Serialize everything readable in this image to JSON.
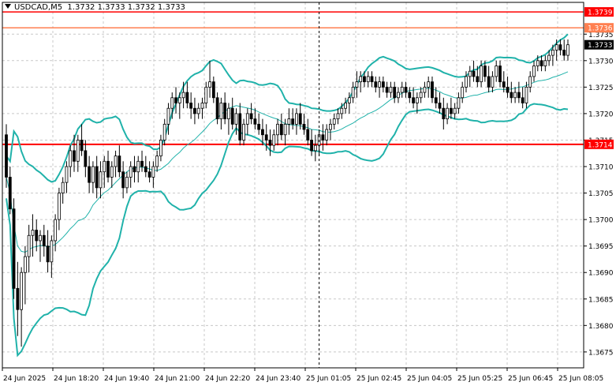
{
  "header": {
    "symbol": "USDCAD,M5",
    "ohlc": "1.3732 1.3733 1.3732 1.3733"
  },
  "colors": {
    "band": "#20b2aa",
    "support": "#ff0000",
    "resistance": "#ff7f50",
    "candle": "#000000",
    "grid": "#c8c8c8",
    "price_tag": "#000000"
  },
  "price_tags": [
    {
      "label": "1.3739",
      "value": 1.37392,
      "color": "#ff0000"
    },
    {
      "label": "1.3736",
      "value": 1.37362,
      "color": "#ff7f50"
    },
    {
      "label": "1.3733",
      "value": 1.3733,
      "color": "#000000"
    },
    {
      "label": "1.3714",
      "value": 1.37142,
      "color": "#ff0000"
    }
  ],
  "chart_data": {
    "type": "candlestick",
    "title": "USDCAD,M5",
    "ylim": [
      1.3672,
      1.3741
    ],
    "y_ticks": [
      "1.3675",
      "1.3680",
      "1.3685",
      "1.3690",
      "1.3695",
      "1.3700",
      "1.3705",
      "1.3710",
      "1.3715",
      "1.3720",
      "1.3725",
      "1.3730",
      "1.3735"
    ],
    "x_labels": [
      "24 Jun 2025",
      "24 Jun 18:20",
      "24 Jun 19:40",
      "24 Jun 21:00",
      "24 Jun 22:20",
      "24 Jun 23:40",
      "25 Jun 01:05",
      "25 Jun 02:45",
      "25 Jun 04:05",
      "25 Jun 05:25",
      "25 Jun 06:45",
      "25 Jun 08:05"
    ],
    "horizontal_levels": [
      {
        "value": 1.37392,
        "color": "#ff0000",
        "style": "solid"
      },
      {
        "value": 1.37362,
        "color": "#ff7f50",
        "style": "solid"
      },
      {
        "value": 1.37142,
        "color": "#ff0000",
        "style": "solid"
      }
    ],
    "vertical_marker": {
      "index": 83,
      "style": "dashed"
    },
    "candles": [
      [
        1.3716,
        1.3718,
        1.3706,
        1.3708
      ],
      [
        1.3708,
        1.371,
        1.3701,
        1.3702
      ],
      [
        1.3702,
        1.3704,
        1.3685,
        1.3687
      ],
      [
        1.3687,
        1.3692,
        1.3678,
        1.3683
      ],
      [
        1.3683,
        1.3691,
        1.3676,
        1.369
      ],
      [
        1.369,
        1.3695,
        1.3684,
        1.3693
      ],
      [
        1.3693,
        1.3699,
        1.369,
        1.3697
      ],
      [
        1.3697,
        1.3701,
        1.3693,
        1.3698
      ],
      [
        1.3698,
        1.37,
        1.3694,
        1.3696
      ],
      [
        1.3696,
        1.3698,
        1.3692,
        1.3697
      ],
      [
        1.3697,
        1.3699,
        1.3693,
        1.3695
      ],
      [
        1.3695,
        1.3698,
        1.369,
        1.3692
      ],
      [
        1.3692,
        1.3697,
        1.3689,
        1.3696
      ],
      [
        1.3696,
        1.3701,
        1.3694,
        1.37
      ],
      [
        1.37,
        1.3706,
        1.3698,
        1.3705
      ],
      [
        1.3705,
        1.3708,
        1.3703,
        1.3707
      ],
      [
        1.3707,
        1.3711,
        1.3705,
        1.371
      ],
      [
        1.371,
        1.3714,
        1.3708,
        1.3713
      ],
      [
        1.3713,
        1.3716,
        1.3709,
        1.3711
      ],
      [
        1.3711,
        1.3716,
        1.3709,
        1.3715
      ],
      [
        1.3715,
        1.3718,
        1.3712,
        1.3713
      ],
      [
        1.3713,
        1.3715,
        1.3708,
        1.371
      ],
      [
        1.371,
        1.3712,
        1.3705,
        1.3707
      ],
      [
        1.3707,
        1.3711,
        1.3705,
        1.371
      ],
      [
        1.371,
        1.3712,
        1.3704,
        1.3706
      ],
      [
        1.3706,
        1.3711,
        1.3704,
        1.3709
      ],
      [
        1.3709,
        1.3712,
        1.3706,
        1.3711
      ],
      [
        1.3711,
        1.3713,
        1.3707,
        1.3708
      ],
      [
        1.3708,
        1.3711,
        1.3706,
        1.371
      ],
      [
        1.371,
        1.3713,
        1.3708,
        1.3712
      ],
      [
        1.3712,
        1.3714,
        1.3708,
        1.3709
      ],
      [
        1.3709,
        1.3711,
        1.3704,
        1.3706
      ],
      [
        1.3706,
        1.3709,
        1.3705,
        1.3708
      ],
      [
        1.3708,
        1.3711,
        1.3706,
        1.371
      ],
      [
        1.371,
        1.3712,
        1.3707,
        1.3709
      ],
      [
        1.3709,
        1.3712,
        1.3707,
        1.3711
      ],
      [
        1.3711,
        1.3713,
        1.3709,
        1.371
      ],
      [
        1.371,
        1.3712,
        1.3708,
        1.3709
      ],
      [
        1.3709,
        1.3711,
        1.3707,
        1.3708
      ],
      [
        1.3708,
        1.3711,
        1.3706,
        1.371
      ],
      [
        1.371,
        1.3713,
        1.3709,
        1.3712
      ],
      [
        1.3712,
        1.3716,
        1.3711,
        1.3715
      ],
      [
        1.3715,
        1.3719,
        1.3714,
        1.3718
      ],
      [
        1.3718,
        1.3722,
        1.3716,
        1.3721
      ],
      [
        1.3721,
        1.3724,
        1.3719,
        1.3723
      ],
      [
        1.3723,
        1.3725,
        1.372,
        1.3722
      ],
      [
        1.3722,
        1.3724,
        1.3719,
        1.3723
      ],
      [
        1.3723,
        1.3726,
        1.3721,
        1.3724
      ],
      [
        1.3724,
        1.3726,
        1.3721,
        1.3722
      ],
      [
        1.3722,
        1.3724,
        1.3719,
        1.3721
      ],
      [
        1.3721,
        1.3723,
        1.3718,
        1.372
      ],
      [
        1.372,
        1.3722,
        1.3719,
        1.3721
      ],
      [
        1.3721,
        1.3723,
        1.3719,
        1.3722
      ],
      [
        1.3722,
        1.3726,
        1.3721,
        1.3725
      ],
      [
        1.3725,
        1.373,
        1.3723,
        1.3726
      ],
      [
        1.3726,
        1.3727,
        1.3722,
        1.3723
      ],
      [
        1.3723,
        1.3724,
        1.3718,
        1.3719
      ],
      [
        1.3719,
        1.3723,
        1.3717,
        1.3722
      ],
      [
        1.3722,
        1.3724,
        1.3718,
        1.3719
      ],
      [
        1.3719,
        1.3722,
        1.3716,
        1.3721
      ],
      [
        1.3721,
        1.3723,
        1.3717,
        1.3718
      ],
      [
        1.3718,
        1.3721,
        1.3716,
        1.372
      ],
      [
        1.372,
        1.3722,
        1.3714,
        1.3715
      ],
      [
        1.3715,
        1.3719,
        1.3714,
        1.3718
      ],
      [
        1.3718,
        1.3721,
        1.3716,
        1.372
      ],
      [
        1.372,
        1.3722,
        1.3718,
        1.3719
      ],
      [
        1.3719,
        1.3721,
        1.3717,
        1.3718
      ],
      [
        1.3718,
        1.372,
        1.3716,
        1.3717
      ],
      [
        1.3717,
        1.3719,
        1.3714,
        1.3716
      ],
      [
        1.3716,
        1.3718,
        1.3713,
        1.3715
      ],
      [
        1.3715,
        1.3717,
        1.3712,
        1.3714
      ],
      [
        1.3714,
        1.3717,
        1.3713,
        1.3716
      ],
      [
        1.3716,
        1.3719,
        1.3714,
        1.3718
      ],
      [
        1.3718,
        1.372,
        1.3715,
        1.3716
      ],
      [
        1.3716,
        1.3719,
        1.3714,
        1.3718
      ],
      [
        1.3718,
        1.3721,
        1.3716,
        1.3719
      ],
      [
        1.3719,
        1.3721,
        1.3717,
        1.3718
      ],
      [
        1.3718,
        1.3721,
        1.3716,
        1.372
      ],
      [
        1.372,
        1.3722,
        1.3717,
        1.3718
      ],
      [
        1.3718,
        1.372,
        1.3716,
        1.3717
      ],
      [
        1.3717,
        1.3719,
        1.3714,
        1.3715
      ],
      [
        1.3715,
        1.3717,
        1.3712,
        1.3713
      ],
      [
        1.3713,
        1.3716,
        1.3711,
        1.3714
      ],
      [
        1.3714,
        1.3717,
        1.3712,
        1.3716
      ],
      [
        1.3716,
        1.3718,
        1.3713,
        1.3715
      ],
      [
        1.3715,
        1.3718,
        1.3714,
        1.3717
      ],
      [
        1.3717,
        1.3719,
        1.3715,
        1.3718
      ],
      [
        1.3718,
        1.372,
        1.3717,
        1.3719
      ],
      [
        1.3719,
        1.3721,
        1.3718,
        1.372
      ],
      [
        1.372,
        1.3722,
        1.3719,
        1.3721
      ],
      [
        1.3721,
        1.3723,
        1.372,
        1.3722
      ],
      [
        1.3722,
        1.3724,
        1.372,
        1.3723
      ],
      [
        1.3723,
        1.3726,
        1.3722,
        1.3725
      ],
      [
        1.3725,
        1.3728,
        1.3723,
        1.3726
      ],
      [
        1.3726,
        1.3728,
        1.3724,
        1.3727
      ],
      [
        1.3727,
        1.3728,
        1.3725,
        1.3726
      ],
      [
        1.3726,
        1.3728,
        1.3725,
        1.3727
      ],
      [
        1.3727,
        1.3728,
        1.3725,
        1.3726
      ],
      [
        1.3726,
        1.3727,
        1.3724,
        1.3725
      ],
      [
        1.3725,
        1.3727,
        1.3723,
        1.3726
      ],
      [
        1.3726,
        1.3727,
        1.3724,
        1.3725
      ],
      [
        1.3725,
        1.3726,
        1.3723,
        1.3724
      ],
      [
        1.3724,
        1.3726,
        1.3723,
        1.3725
      ],
      [
        1.3725,
        1.3726,
        1.3722,
        1.3723
      ],
      [
        1.3723,
        1.3725,
        1.3722,
        1.3724
      ],
      [
        1.3724,
        1.3726,
        1.3723,
        1.3725
      ],
      [
        1.3725,
        1.3726,
        1.3723,
        1.3724
      ],
      [
        1.3724,
        1.3725,
        1.3722,
        1.3723
      ],
      [
        1.3723,
        1.3725,
        1.3721,
        1.3722
      ],
      [
        1.3722,
        1.3724,
        1.372,
        1.3723
      ],
      [
        1.3723,
        1.3725,
        1.3722,
        1.3724
      ],
      [
        1.3724,
        1.3726,
        1.3723,
        1.3725
      ],
      [
        1.3725,
        1.3727,
        1.3723,
        1.3726
      ],
      [
        1.3726,
        1.3727,
        1.3722,
        1.3723
      ],
      [
        1.3723,
        1.3725,
        1.3721,
        1.3722
      ],
      [
        1.3722,
        1.3724,
        1.372,
        1.3721
      ],
      [
        1.3721,
        1.3723,
        1.3717,
        1.3719
      ],
      [
        1.3719,
        1.3722,
        1.3718,
        1.3721
      ],
      [
        1.3721,
        1.3723,
        1.3719,
        1.372
      ],
      [
        1.372,
        1.3722,
        1.3719,
        1.3721
      ],
      [
        1.3721,
        1.3724,
        1.372,
        1.3723
      ],
      [
        1.3723,
        1.3726,
        1.3722,
        1.3725
      ],
      [
        1.3725,
        1.3728,
        1.3724,
        1.3727
      ],
      [
        1.3727,
        1.3729,
        1.3725,
        1.3728
      ],
      [
        1.3728,
        1.373,
        1.3726,
        1.3727
      ],
      [
        1.3727,
        1.3729,
        1.3725,
        1.3726
      ],
      [
        1.3726,
        1.373,
        1.3725,
        1.3729
      ],
      [
        1.3729,
        1.373,
        1.3726,
        1.3727
      ],
      [
        1.3727,
        1.3729,
        1.3724,
        1.3725
      ],
      [
        1.3725,
        1.3728,
        1.3724,
        1.3727
      ],
      [
        1.3727,
        1.373,
        1.3726,
        1.3729
      ],
      [
        1.3729,
        1.373,
        1.3725,
        1.3726
      ],
      [
        1.3726,
        1.3728,
        1.3724,
        1.3725
      ],
      [
        1.3725,
        1.3727,
        1.3723,
        1.3724
      ],
      [
        1.3724,
        1.3726,
        1.3722,
        1.3723
      ],
      [
        1.3723,
        1.3725,
        1.3722,
        1.3724
      ],
      [
        1.3724,
        1.3726,
        1.3722,
        1.3723
      ],
      [
        1.3723,
        1.3725,
        1.3721,
        1.3722
      ],
      [
        1.3722,
        1.3726,
        1.3721,
        1.3725
      ],
      [
        1.3725,
        1.3728,
        1.3724,
        1.3727
      ],
      [
        1.3727,
        1.373,
        1.3726,
        1.3729
      ],
      [
        1.3729,
        1.3731,
        1.3728,
        1.373
      ],
      [
        1.373,
        1.3731,
        1.3728,
        1.3729
      ],
      [
        1.3729,
        1.3731,
        1.3728,
        1.373
      ],
      [
        1.373,
        1.3732,
        1.3729,
        1.3731
      ],
      [
        1.3731,
        1.3733,
        1.3729,
        1.3732
      ],
      [
        1.3732,
        1.3734,
        1.373,
        1.3733
      ],
      [
        1.3733,
        1.3734,
        1.3731,
        1.3732
      ],
      [
        1.3732,
        1.3734,
        1.373,
        1.3731
      ],
      [
        1.3731,
        1.3734,
        1.373,
        1.3733
      ]
    ]
  }
}
